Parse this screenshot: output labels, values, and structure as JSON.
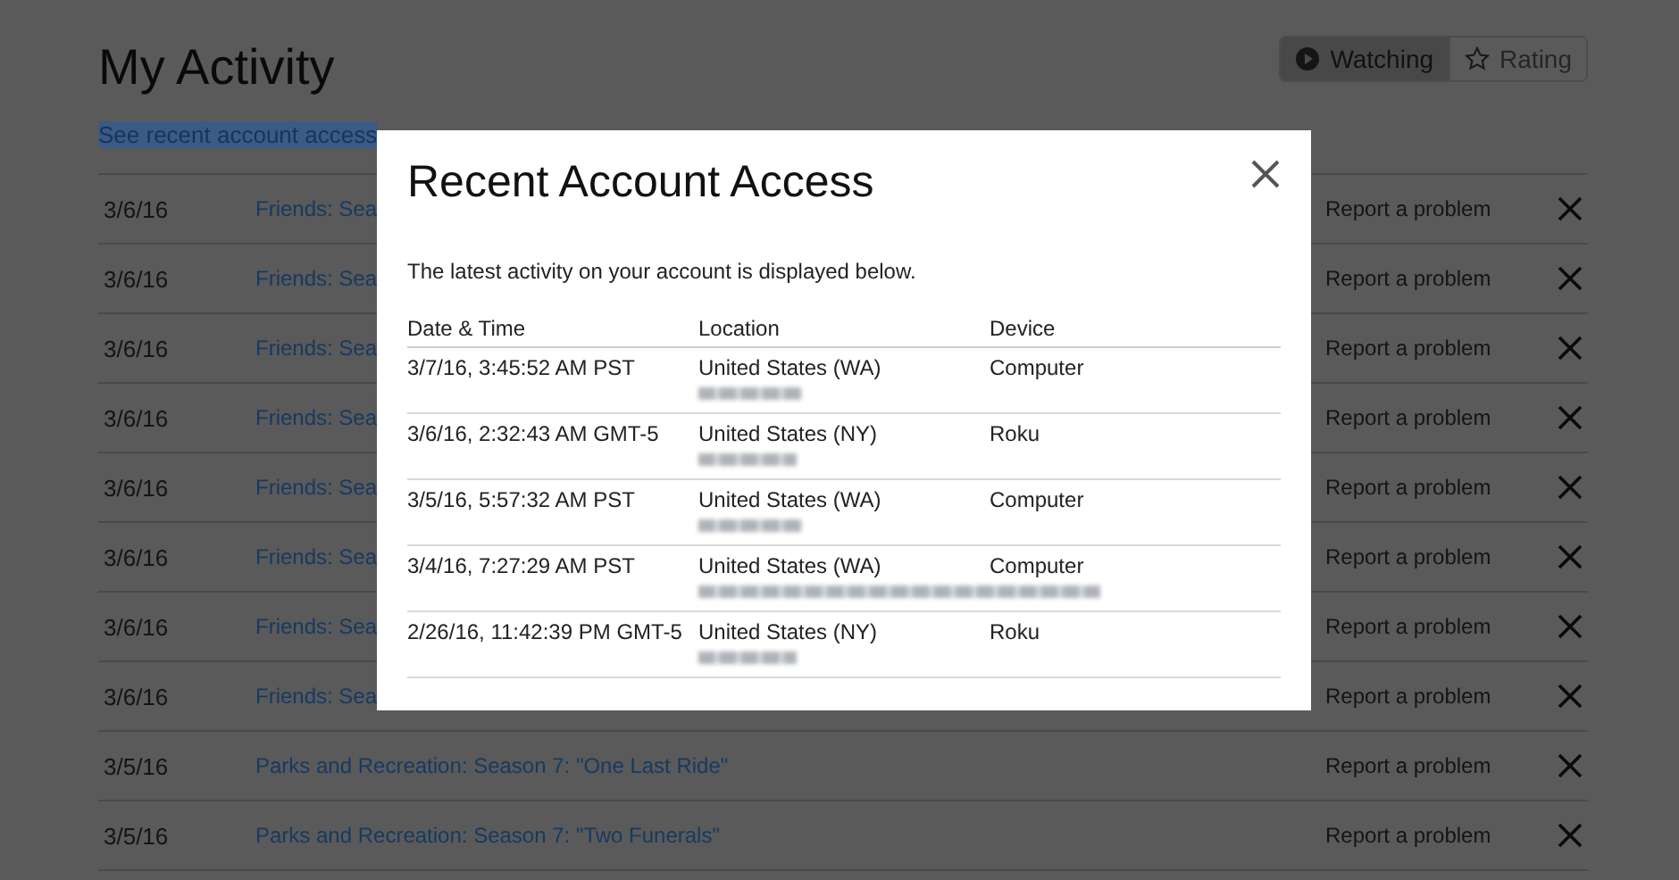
{
  "page": {
    "title": "My Activity",
    "recent_access_link": {
      "label": "See recent account access",
      "highlighted": true
    },
    "view_toggle": [
      {
        "label": "Watching",
        "selected": true
      },
      {
        "label": "Rating",
        "selected": false
      }
    ]
  },
  "activity_rows": [
    {
      "date": "3/6/16",
      "title": "Friends: Sea",
      "report": "Report a problem"
    },
    {
      "date": "3/6/16",
      "title": "Friends: Sea",
      "report": "Report a problem"
    },
    {
      "date": "3/6/16",
      "title": "Friends: Sea",
      "report": "Report a problem"
    },
    {
      "date": "3/6/16",
      "title": "Friends: Sea",
      "report": "Report a problem"
    },
    {
      "date": "3/6/16",
      "title": "Friends: Sea",
      "report": "Report a problem"
    },
    {
      "date": "3/6/16",
      "title": "Friends: Sea",
      "report": "Report a problem"
    },
    {
      "date": "3/6/16",
      "title": "Friends: Sea",
      "report": "Report a problem"
    },
    {
      "date": "3/6/16",
      "title": "Friends: Sea",
      "report": "Report a problem"
    },
    {
      "date": "3/5/16",
      "title": "Parks and Recreation: Season 7: \"One Last Ride\"",
      "report": "Report a problem"
    },
    {
      "date": "3/5/16",
      "title": "Parks and Recreation: Season 7: \"Two Funerals\"",
      "report": "Report a problem"
    }
  ],
  "modal": {
    "title": "Recent Account Access",
    "intro": "The latest activity on your account is displayed below.",
    "columns": [
      "Date & Time",
      "Location",
      "Device"
    ],
    "rows": [
      {
        "date_time": "3/7/16, 3:45:52 AM PST",
        "location": "United States (WA)",
        "device": "Computer"
      },
      {
        "date_time": "3/6/16, 2:32:43 AM GMT-5",
        "location": "United States (NY)",
        "device": "Roku"
      },
      {
        "date_time": "3/5/16, 5:57:32 AM PST",
        "location": "United States (WA)",
        "device": "Computer"
      },
      {
        "date_time": "3/4/16, 7:27:29 AM PST",
        "location": "United States (WA)",
        "device": "Computer"
      },
      {
        "date_time": "2/26/16, 11:42:39 PM GMT-5",
        "location": "United States (NY)",
        "device": "Roku"
      }
    ]
  }
}
